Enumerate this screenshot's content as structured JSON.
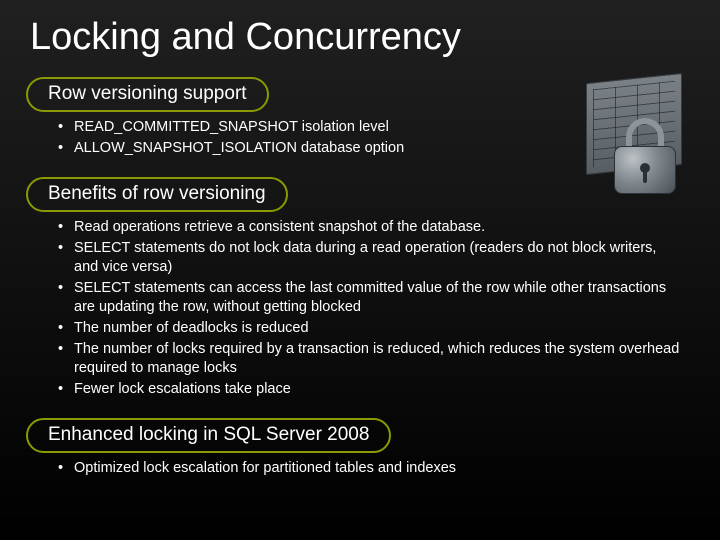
{
  "title": "Locking and Concurrency",
  "sections": [
    {
      "header": "Row versioning support",
      "bullets": [
        "READ_COMMITTED_SNAPSHOT isolation level",
        "ALLOW_SNAPSHOT_ISOLATION database option"
      ]
    },
    {
      "header": "Benefits of row versioning",
      "bullets": [
        "Read operations retrieve a consistent snapshot of the database.",
        "SELECT statements do not lock data during a read operation (readers do not block writers, and vice versa)",
        "SELECT statements can access the last committed value of the row while other transactions are updating the row, without getting blocked",
        "The number of deadlocks is reduced",
        "The number of locks required by a transaction is reduced, which reduces the system overhead required to manage locks",
        "Fewer lock escalations take place"
      ]
    },
    {
      "header": "Enhanced locking in SQL Server 2008",
      "bullets": [
        "Optimized lock escalation  for partitioned tables and indexes"
      ]
    }
  ]
}
